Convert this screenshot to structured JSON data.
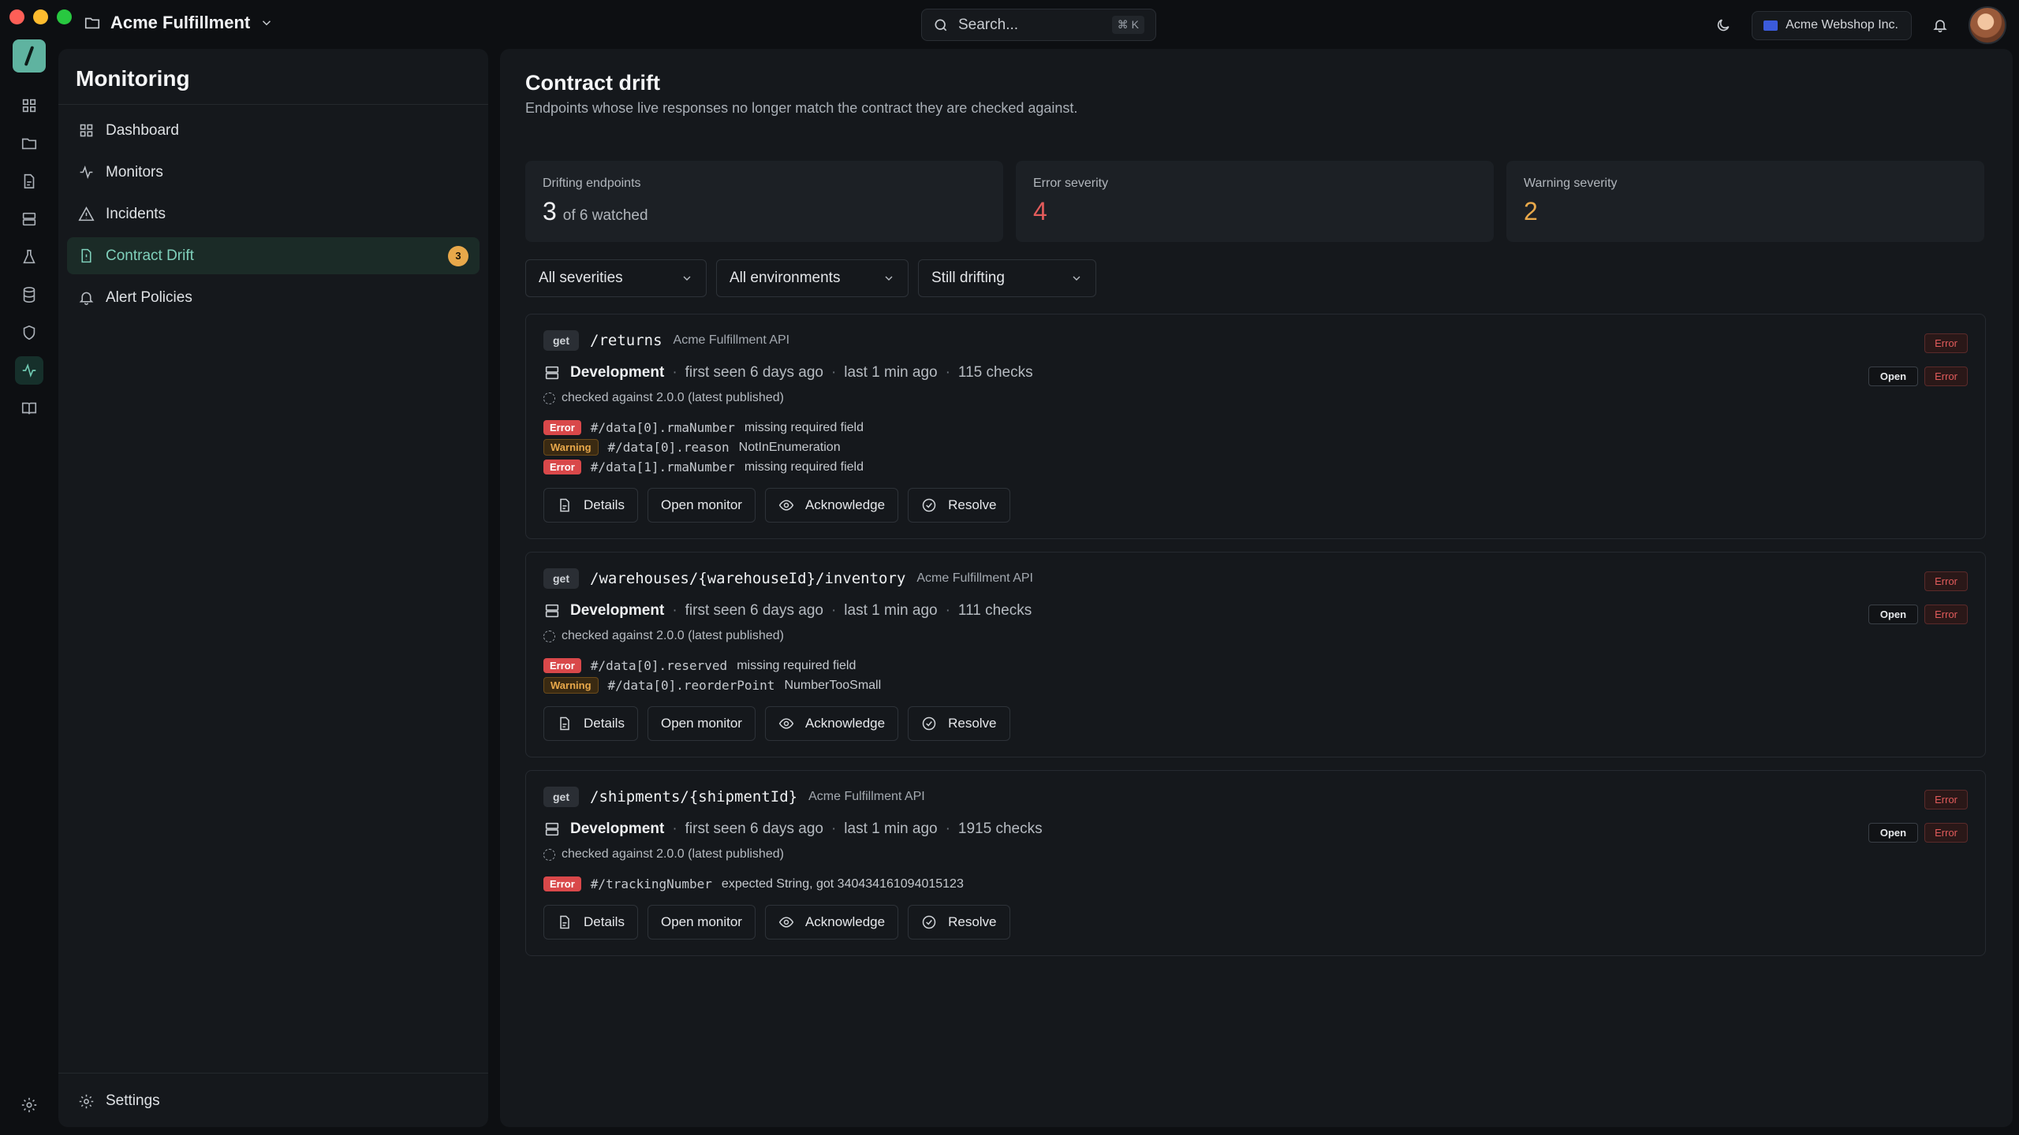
{
  "titlebar": {
    "project_name": "Acme Fulfillment",
    "search_placeholder": "Search...",
    "search_shortcut": "⌘ K",
    "org_name": "Acme Webshop Inc."
  },
  "sidebar": {
    "title": "Monitoring",
    "items": [
      {
        "label": "Dashboard",
        "icon": "grid-icon"
      },
      {
        "label": "Monitors",
        "icon": "pulse-icon"
      },
      {
        "label": "Incidents",
        "icon": "warning-icon"
      },
      {
        "label": "Contract Drift",
        "icon": "file-icon",
        "count": "3",
        "active": true
      },
      {
        "label": "Alert Policies",
        "icon": "bell-icon"
      }
    ],
    "settings_label": "Settings"
  },
  "main": {
    "title": "Contract drift",
    "subtitle": "Endpoints whose live responses no longer match the contract they are checked against.",
    "stats": [
      {
        "label": "Drifting endpoints",
        "value": "3",
        "suffix": "of 6 watched"
      },
      {
        "label": "Error severity",
        "value": "4"
      },
      {
        "label": "Warning severity",
        "value": "2"
      }
    ],
    "filters": [
      "All severities",
      "All environments",
      "Still drifting"
    ],
    "cards": [
      {
        "method": "get",
        "path": "/returns",
        "api": "Acme Fulfillment API",
        "severity": "Error",
        "env": "Development",
        "first_seen": "first seen 6 days ago",
        "last": "last 1 min ago",
        "checks": "115 checks",
        "status": "Open",
        "checked_against": "checked against 2.0.0 (latest published)",
        "issues": [
          {
            "level": "Error",
            "pointer": "#/data[0].rmaNumber",
            "message": "missing required field"
          },
          {
            "level": "Warning",
            "pointer": "#/data[0].reason",
            "message": "NotInEnumeration"
          },
          {
            "level": "Error",
            "pointer": "#/data[1].rmaNumber",
            "message": "missing required field"
          }
        ]
      },
      {
        "method": "get",
        "path": "/warehouses/{warehouseId}/inventory",
        "api": "Acme Fulfillment API",
        "severity": "Error",
        "env": "Development",
        "first_seen": "first seen 6 days ago",
        "last": "last 1 min ago",
        "checks": "111 checks",
        "status": "Open",
        "checked_against": "checked against 2.0.0 (latest published)",
        "issues": [
          {
            "level": "Error",
            "pointer": "#/data[0].reserved",
            "message": "missing required field"
          },
          {
            "level": "Warning",
            "pointer": "#/data[0].reorderPoint",
            "message": "NumberTooSmall"
          }
        ]
      },
      {
        "method": "get",
        "path": "/shipments/{shipmentId}",
        "api": "Acme Fulfillment API",
        "severity": "Error",
        "env": "Development",
        "first_seen": "first seen 6 days ago",
        "last": "last 1 min ago",
        "checks": "1915 checks",
        "status": "Open",
        "checked_against": "checked against 2.0.0 (latest published)",
        "issues": [
          {
            "level": "Error",
            "pointer": "#/trackingNumber",
            "message": "expected String, got 340434161094015123"
          }
        ]
      }
    ],
    "actions": {
      "details": "Details",
      "open_monitor": "Open monitor",
      "acknowledge": "Acknowledge",
      "resolve": "Resolve"
    }
  }
}
